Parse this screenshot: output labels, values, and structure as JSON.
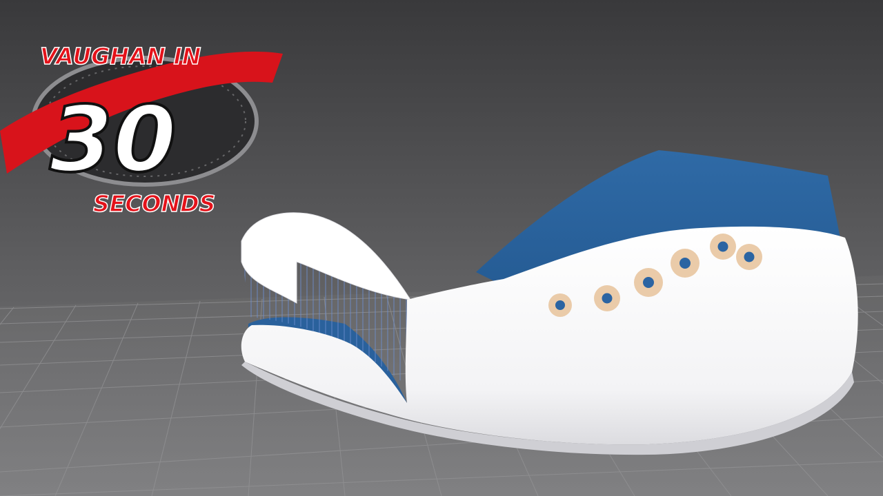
{
  "logo": {
    "title_line": "VAUGHAN IN",
    "number": "30",
    "subtitle": "SECONDS"
  },
  "colors": {
    "background_top": "#3b3b3d",
    "background_bottom": "#7a7a7c",
    "grid_line": "#8c8c8e",
    "shoe_white": "#ffffff",
    "shoe_blue": "#2f6aa6",
    "eyelet_ring": "#e8c9a8",
    "logo_red": "#d8131b"
  },
  "icons": [
    "stopwatch-icon",
    "eyelet-icon"
  ]
}
